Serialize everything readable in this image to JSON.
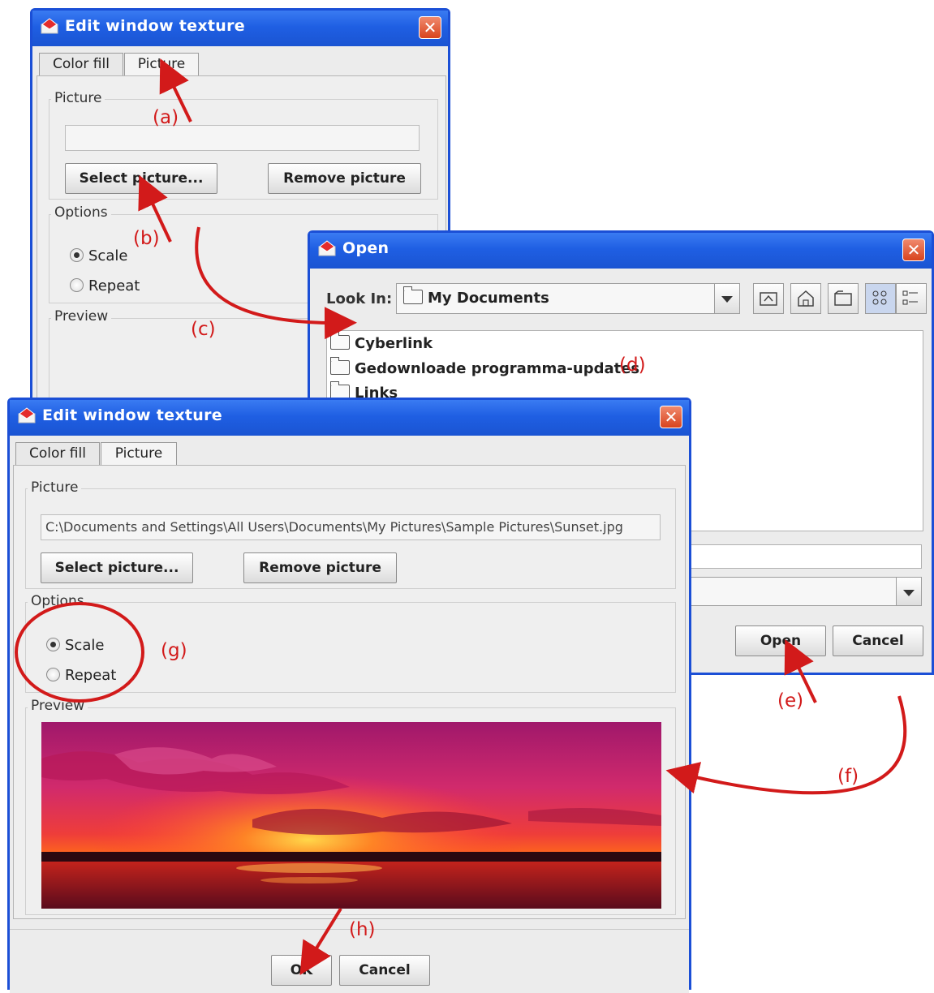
{
  "win1": {
    "title": "Edit window texture",
    "close_label": "✕",
    "tabs": [
      "Color fill",
      "Picture"
    ],
    "picture_group_label": "Picture",
    "path_value": "",
    "select_picture_label": "Select picture...",
    "remove_picture_label": "Remove picture",
    "options_group_label": "Options",
    "scale_label": "Scale",
    "repeat_label": "Repeat",
    "preview_group_label": "Preview"
  },
  "open_dialog": {
    "title": "Open",
    "close_label": "✕",
    "look_in_label": "Look In:",
    "look_in_value": "My Documents",
    "files": [
      "Cyberlink",
      "Gedownloade programma-updates",
      "Links"
    ],
    "open_label": "Open",
    "cancel_label": "Cancel",
    "toolbar_icons": [
      "up-folder-icon",
      "home-icon",
      "new-folder-icon",
      "list-view-icon",
      "details-view-icon"
    ]
  },
  "win2": {
    "title": "Edit window texture",
    "close_label": "✕",
    "tabs": [
      "Color fill",
      "Picture"
    ],
    "picture_group_label": "Picture",
    "path_value": "C:\\Documents and Settings\\All Users\\Documents\\My Pictures\\Sample Pictures\\Sunset.jpg",
    "select_picture_label": "Select picture...",
    "remove_picture_label": "Remove picture",
    "options_group_label": "Options",
    "scale_label": "Scale",
    "repeat_label": "Repeat",
    "preview_group_label": "Preview",
    "ok_label": "OK",
    "cancel_label": "Cancel"
  },
  "annotations": {
    "a": "(a)",
    "b": "(b)",
    "c": "(c)",
    "d": "(d)",
    "e": "(e)",
    "f": "(f)",
    "g": "(g)",
    "h": "(h)"
  },
  "colors": {
    "titlebar": "#1f5fe3",
    "annotation": "#d21a1a",
    "close_button": "#d8431d"
  }
}
